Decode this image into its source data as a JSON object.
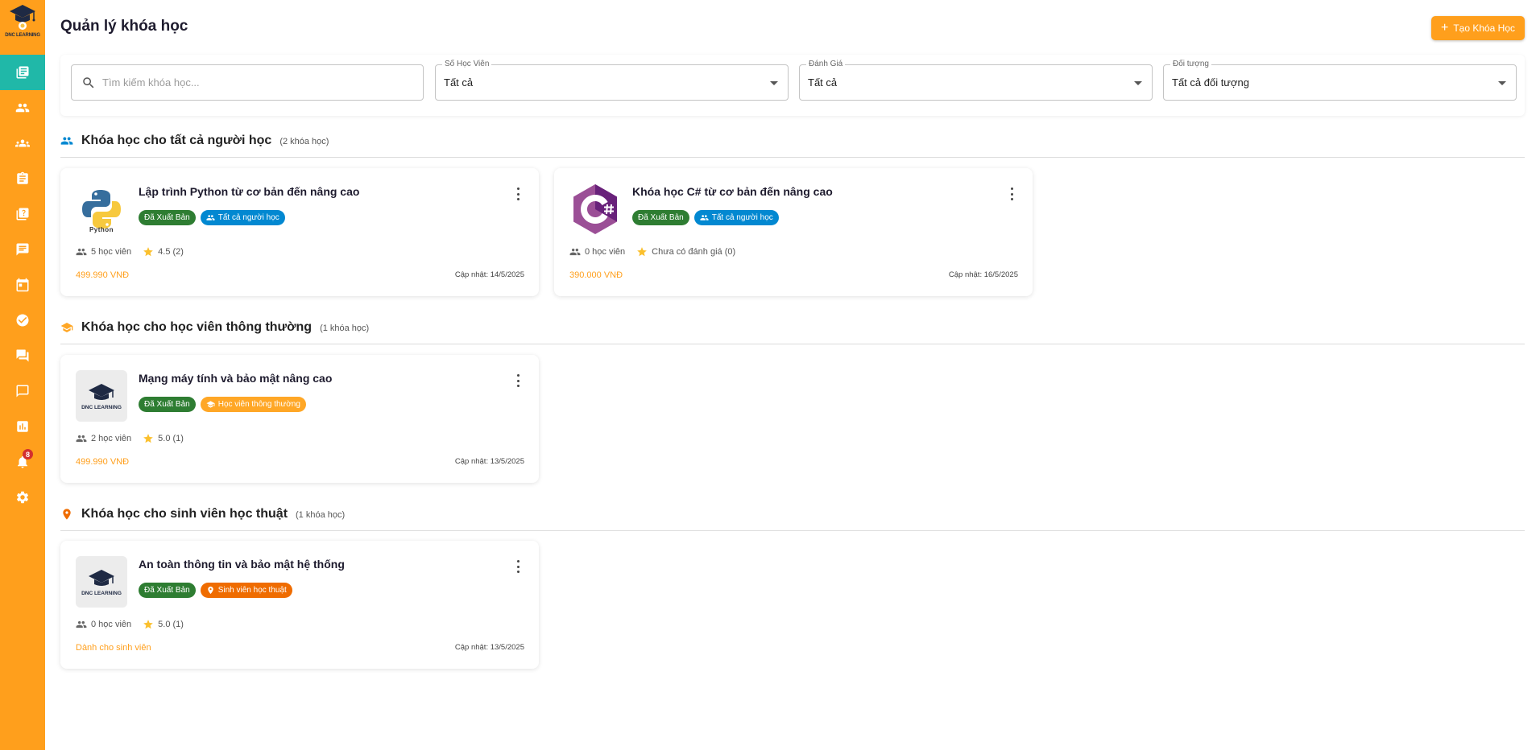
{
  "sidebar": {
    "logo_text": "DNC LEARNING",
    "items": [
      {
        "icon": "book-icon"
      },
      {
        "icon": "people-icon"
      },
      {
        "icon": "group-icon"
      },
      {
        "icon": "assignment-icon"
      },
      {
        "icon": "quiz-icon"
      },
      {
        "icon": "comment-icon"
      },
      {
        "icon": "calendar-icon"
      },
      {
        "icon": "check-circle-icon"
      },
      {
        "icon": "forum-icon"
      },
      {
        "icon": "chat-icon"
      },
      {
        "icon": "bar-chart-icon"
      },
      {
        "icon": "bell-icon",
        "badge": "8"
      },
      {
        "icon": "gear-icon"
      }
    ]
  },
  "header": {
    "title": "Quản lý khóa học",
    "create_button": "Tạo Khóa Học"
  },
  "filters": {
    "search_placeholder": "Tìm kiếm khóa học...",
    "students": {
      "label": "Số Học Viên",
      "value": "Tất cả"
    },
    "rating": {
      "label": "Đánh Giá",
      "value": "Tất cả"
    },
    "audience": {
      "label": "Đối tượng",
      "value": "Tất cả đối tượng"
    }
  },
  "colors": {
    "brand_orange": "#ff9f1c",
    "active_teal": "#20b8a8",
    "published_green": "#2e7d32",
    "all_learners_blue": "#0288d1",
    "regular_orange": "#ffa726",
    "academic_orange": "#ef6c00"
  },
  "sections": [
    {
      "title": "Khóa học cho tất cả người học",
      "count": "(2 khóa học)",
      "courses": [
        {
          "title": "Lập trình Python từ cơ bản đến nâng cao",
          "thumb": "python-logo",
          "thumb_text": "Python",
          "status": "Đã Xuất Bản",
          "audience": "Tất cả người học",
          "students": "5 học viên",
          "rating": "4.5 (2)",
          "price": "499.990 VNĐ",
          "updated": "Cập nhật: 14/5/2025"
        },
        {
          "title": "Khóa học C# từ cơ bản đến nâng cao",
          "thumb": "csharp-logo",
          "status": "Đã Xuất Bản",
          "audience": "Tất cả người học",
          "students": "0 học viên",
          "rating": "Chưa có đánh giá (0)",
          "price": "390.000 VNĐ",
          "updated": "Cập nhật: 16/5/2025"
        }
      ]
    },
    {
      "title": "Khóa học cho học viên thông thường",
      "count": "(1 khóa học)",
      "courses": [
        {
          "title": "Mạng máy tính và bảo mật nâng cao",
          "thumb": "dnc-placeholder",
          "thumb_text": "DNC LEARNING",
          "status": "Đã Xuất Bản",
          "audience": "Học viên thông thường",
          "students": "2 học viên",
          "rating": "5.0 (1)",
          "price": "499.990 VNĐ",
          "updated": "Cập nhật: 13/5/2025"
        }
      ]
    },
    {
      "title": "Khóa học cho sinh viên học thuật",
      "count": "(1 khóa học)",
      "courses": [
        {
          "title": "An toàn thông tin và bảo mật hệ thống",
          "thumb": "dnc-placeholder",
          "thumb_text": "DNC LEARNING",
          "status": "Đã Xuất Bản",
          "audience": "Sinh viên học thuật",
          "students": "0 học viên",
          "rating": "5.0 (1)",
          "price": "Dành cho sinh viên",
          "updated": "Cập nhật: 13/5/2025"
        }
      ]
    }
  ]
}
